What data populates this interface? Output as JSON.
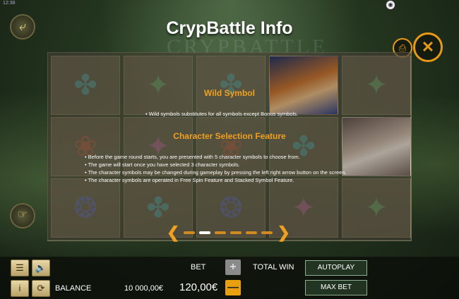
{
  "status": {
    "clock": "12:38"
  },
  "header": {
    "title": "CrypBattle Info",
    "logo_text": "CRYPBATTLE"
  },
  "buttons": {
    "back_icon": "back-arrow-icon",
    "print_icon": "print-icon",
    "close_icon": "close-icon"
  },
  "grid": {
    "cells": [
      {
        "kind": "rune",
        "color": "teal",
        "glyph": "✤"
      },
      {
        "kind": "rune",
        "color": "green",
        "glyph": "✦"
      },
      {
        "kind": "rune",
        "color": "teal",
        "glyph": "✤"
      },
      {
        "kind": "character",
        "color": "orange",
        "glyph": ""
      },
      {
        "kind": "rune",
        "color": "green",
        "glyph": "✦"
      },
      {
        "kind": "rune",
        "color": "red",
        "glyph": "❀"
      },
      {
        "kind": "rune",
        "color": "pink",
        "glyph": "✦"
      },
      {
        "kind": "rune",
        "color": "red",
        "glyph": "❀"
      },
      {
        "kind": "rune",
        "color": "teal",
        "glyph": "✤"
      },
      {
        "kind": "character",
        "color": "white",
        "glyph": ""
      },
      {
        "kind": "rune",
        "color": "blue",
        "glyph": "❂"
      },
      {
        "kind": "rune",
        "color": "teal",
        "glyph": "✤"
      },
      {
        "kind": "rune",
        "color": "blue",
        "glyph": "❂"
      },
      {
        "kind": "rune",
        "color": "pink",
        "glyph": "✦"
      },
      {
        "kind": "rune",
        "color": "green",
        "glyph": "✦"
      }
    ]
  },
  "info": {
    "wild_heading": "Wild Symbol",
    "wild_text": "Wild symbols substitutes for all symbols except Bonus symbols.",
    "char_heading": "Character Selection Feature",
    "char_bullets": [
      "Before the game round starts, you are presented with 5 character symbols to choose from.",
      "The game will start once you have selected 3 character symbols.",
      "The character symbols may be changed during gameplay by pressing the left right arrow button on the screen.",
      "The character symbols are operated in Free Spin Feature and Stacked Symbol Feature."
    ]
  },
  "pager": {
    "total_pages": 6,
    "current_page": 1
  },
  "bottom": {
    "balance_label": "BALANCE",
    "balance_value": "10 000,00€",
    "bet_label": "BET",
    "bet_value": "120,00€",
    "total_win_label": "TOTAL WIN",
    "autoplay_label": "AUTOPLAY",
    "max_bet_label": "MAX BET"
  }
}
